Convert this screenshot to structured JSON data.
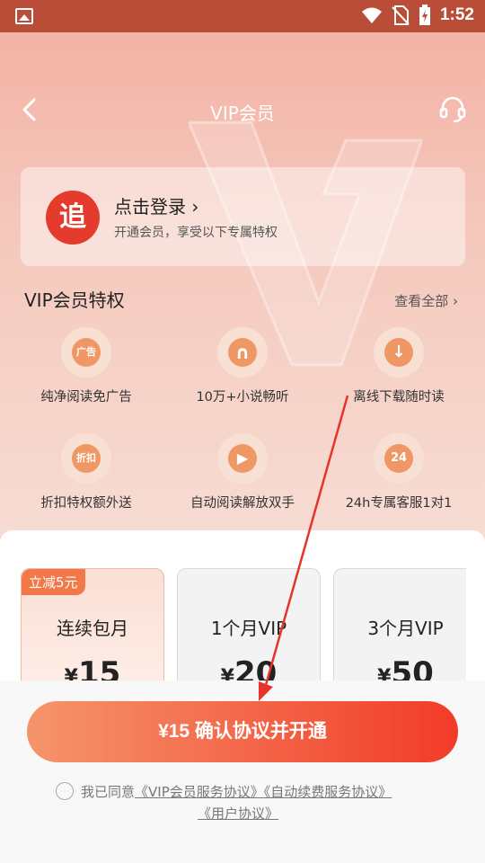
{
  "status_bar": {
    "time": "1:52"
  },
  "header": {
    "title": "VIP会员"
  },
  "login": {
    "logo_char": "追",
    "title": "点击登录",
    "subtitle": "开通会员，享受以下专属特权"
  },
  "privileges": {
    "title": "VIP会员特权",
    "view_all": "查看全部",
    "items": [
      {
        "label": "纯净阅读免广告",
        "icon": "no-ads-icon",
        "glyph": "广告"
      },
      {
        "label": "10万+小说畅听",
        "icon": "headphones-book-icon",
        "glyph": "∩"
      },
      {
        "label": "离线下载随时读",
        "icon": "cloud-download-icon",
        "glyph": "↓"
      },
      {
        "label": "折扣特权额外送",
        "icon": "discount-icon",
        "glyph": "折扣"
      },
      {
        "label": "自动阅读解放双手",
        "icon": "auto-read-book-icon",
        "glyph": "▶"
      },
      {
        "label": "24h专属客服1对1",
        "icon": "24h-service-icon",
        "glyph": "24"
      }
    ]
  },
  "plans": [
    {
      "name": "连续包月",
      "currency": "¥",
      "price": "15",
      "badge": "立减5元",
      "selected": true
    },
    {
      "name": "1个月VIP",
      "currency": "¥",
      "price": "20"
    },
    {
      "name": "3个月VIP",
      "currency": "¥",
      "price": "50"
    }
  ],
  "cta": {
    "label": "¥15 确认协议并开通"
  },
  "agreement": {
    "prefix": "我已同意",
    "link1": "《VIP会员服务协议》",
    "link2": "《自动续费服务协议》",
    "link3": "《用户协议》"
  },
  "colors": {
    "status_bar": "#b94d37",
    "accent": "#f23b28",
    "icon_orange": "#ef9865"
  }
}
